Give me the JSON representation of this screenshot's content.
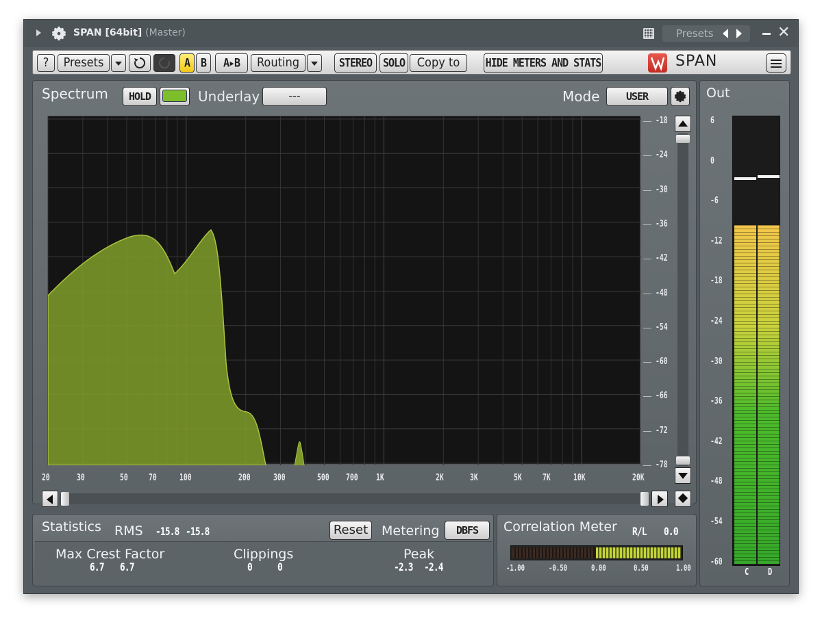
{
  "titlebar": {
    "title": "SPAN [64bit]",
    "subtitle": "(Master)",
    "presets_label": "Presets"
  },
  "toolbar": {
    "help_label": "?",
    "presets_label": "Presets",
    "a_label": "A",
    "b_label": "B",
    "atob_label": "A▸B",
    "routing_label": "Routing",
    "stereo_label": "STEREO",
    "solo_label": "SOLO",
    "copyto_label": "Copy to",
    "hide_meters_label": "HIDE METERS AND STATS",
    "logo_text": "SPAN"
  },
  "spectrum": {
    "title": "Spectrum",
    "hold_label": "HOLD",
    "underlay_label": "Underlay",
    "underlay_value": "---",
    "mode_label": "Mode",
    "mode_value": "USER",
    "db_labels": [
      "-18",
      "-24",
      "-30",
      "-36",
      "-42",
      "-48",
      "-54",
      "-60",
      "-66",
      "-72",
      "-78"
    ],
    "freq_labels": [
      "20",
      "30",
      "50",
      "70",
      "100",
      "200",
      "300",
      "500",
      "700",
      "1K",
      "2K",
      "3K",
      "5K",
      "7K",
      "10K",
      "20K"
    ],
    "fill_color": "#7d9a2a"
  },
  "statistics": {
    "title": "Statistics",
    "rms_label": "RMS",
    "rms_left": "-15.8",
    "rms_right": "-15.8",
    "reset_label": "Reset",
    "metering_label": "Metering",
    "metering_value": "DBFS",
    "crest_label": "Max Crest Factor",
    "crest_left": "6.7",
    "crest_right": "6.7",
    "clip_label": "Clippings",
    "clip_left": "0",
    "clip_right": "0",
    "peak_label": "Peak",
    "peak_left": "-2.3",
    "peak_right": "-2.4"
  },
  "correlation": {
    "title": "Correlation Meter",
    "mode_label": "R/L",
    "value": "0.0",
    "scale": [
      "-1.00",
      "-0.50",
      "0.00",
      "0.50",
      "1.00"
    ]
  },
  "output": {
    "title": "Out",
    "scale": [
      "6",
      "0",
      "-6",
      "-12",
      "-18",
      "-24",
      "-30",
      "-36",
      "-42",
      "-48",
      "-54",
      "-60"
    ],
    "channel_left": "C",
    "channel_right": "D",
    "level_db": -10,
    "peak_left_db": -3.0,
    "peak_right_db": -2.7
  }
}
